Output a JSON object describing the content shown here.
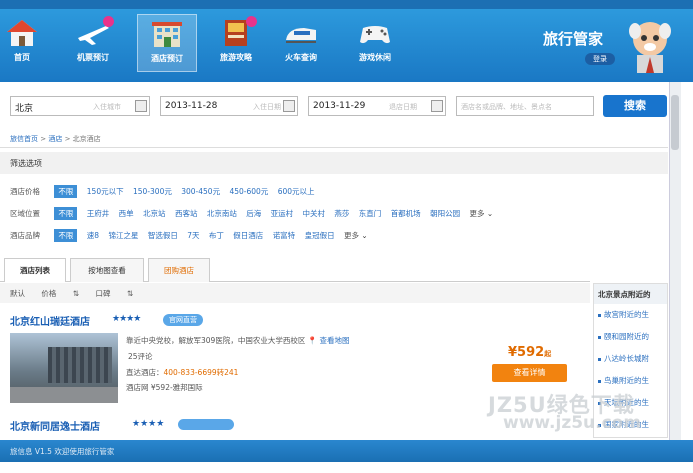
{
  "app": {
    "brand": "旅行管家",
    "login_label": "登录",
    "status_text": "旅信息  V1.5 欢迎使用旅行管家"
  },
  "nav": {
    "items": [
      {
        "label": "首页",
        "icon": "home-icon"
      },
      {
        "label": "机票预订",
        "icon": "airplane-icon"
      },
      {
        "label": "酒店预订",
        "icon": "hotel-icon"
      },
      {
        "label": "旅游攻略",
        "icon": "guidebook-icon"
      },
      {
        "label": "火车查询",
        "icon": "train-icon"
      },
      {
        "label": "游戏休闲",
        "icon": "gamepad-icon"
      }
    ],
    "active_index": 2
  },
  "search": {
    "city_value": "北京",
    "city_placeholder": "入住城市",
    "checkin_value": "2013-11-28",
    "checkin_placeholder": "入住日期",
    "checkout_value": "2013-11-29",
    "checkout_placeholder": "退店日期",
    "keyword_placeholder": "酒店名或品牌、地址、景点名",
    "button_label": "搜索"
  },
  "breadcrumb": {
    "home": "旅信首页",
    "section": "酒店",
    "current": "北京酒店"
  },
  "filters": {
    "title": "筛选选项",
    "price": {
      "label": "酒店价格",
      "options": [
        "不限",
        "150元以下",
        "150-300元",
        "300-450元",
        "450-600元",
        "600元以上"
      ]
    },
    "area": {
      "label": "区域位置",
      "options": [
        "不限",
        "王府井",
        "西单",
        "北京站",
        "西客站",
        "北京南站",
        "后海",
        "亚运村",
        "中关村",
        "燕莎",
        "东直门",
        "首都机场",
        "朝阳公园"
      ],
      "more": "更多"
    },
    "brand": {
      "label": "酒店品牌",
      "options": [
        "不限",
        "速8",
        "锦江之星",
        "智选假日",
        "7天",
        "布丁",
        "假日酒店",
        "诺富特",
        "皇冠假日"
      ],
      "more": "更多"
    }
  },
  "tabs": [
    "酒店列表",
    "按地图查看",
    "团购酒店"
  ],
  "sort": [
    "默认",
    "价格",
    "口碑"
  ],
  "hotels": [
    {
      "name": "北京红山瑞廷酒店",
      "stars": "★★★★",
      "type_tag": "官网直营",
      "address": "靠近中央党校，解放军309医院，中国农业大学西校区",
      "map_link": "查看地图",
      "reviews": "25评论",
      "phone_label": "直达酒店：",
      "phone": "400-833-6699转241",
      "brand_label": "酒店网",
      "brand_price": "¥592-雅邦国际",
      "price": "¥592",
      "price_suffix": "起",
      "detail_label": "查看详情"
    },
    {
      "name": "北京新同居逸士酒店",
      "stars": "★★★★"
    }
  ],
  "sidebar": {
    "title": "北京景点附近的",
    "items": [
      "故宫附近的生",
      "颐和园附近的",
      "八达岭长城附",
      "鸟巢附近的生",
      "天坛附近的生",
      "国家附近的生"
    ]
  },
  "watermark": {
    "line1": "JZ5U绿色下载",
    "line2": "www.jz5u.com"
  },
  "colors": {
    "header_blue": "#1a78c4",
    "accent_orange": "#f2830f",
    "link_blue": "#2a6fbf",
    "badge_pink": "#e8338b"
  }
}
